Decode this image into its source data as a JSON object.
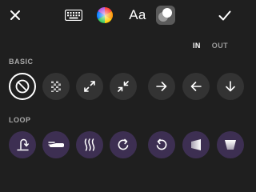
{
  "toolbar": {
    "items": [
      {
        "name": "close-icon"
      },
      {
        "name": "keyboard-icon"
      },
      {
        "name": "color-wheel-icon"
      },
      {
        "name": "text-style-icon",
        "label": "Aa"
      },
      {
        "name": "effects-icon"
      },
      {
        "name": "checkmark-icon"
      }
    ],
    "text_style_label": "Aa"
  },
  "tabs": {
    "in_label": "IN",
    "out_label": "OUT",
    "selected": "IN"
  },
  "sections": {
    "basic_label": "BASIC",
    "loop_label": "LOOP"
  },
  "basic_effects": [
    {
      "icon": "none-icon",
      "selected": true
    },
    {
      "icon": "fade-icon"
    },
    {
      "icon": "zoom-out-icon"
    },
    {
      "icon": "zoom-in-icon"
    },
    {
      "icon": "slide-right-icon"
    },
    {
      "icon": "slide-left-icon"
    },
    {
      "icon": "slide-down-icon"
    }
  ],
  "loop_effects": [
    {
      "icon": "bounce-icon"
    },
    {
      "icon": "slide-loop-icon"
    },
    {
      "icon": "wave-icon"
    },
    {
      "icon": "rotate-clockwise-icon"
    },
    {
      "icon": "rotate-counterclockwise-icon"
    },
    {
      "icon": "perspective-left-icon"
    },
    {
      "icon": "perspective-down-icon"
    }
  ],
  "colors": {
    "background": "#1f1f1f",
    "basic_button": "#333333",
    "loop_button": "#3d2f52",
    "inactive_tab": "#9a9a9a",
    "section_label": "#a8a8a8"
  }
}
